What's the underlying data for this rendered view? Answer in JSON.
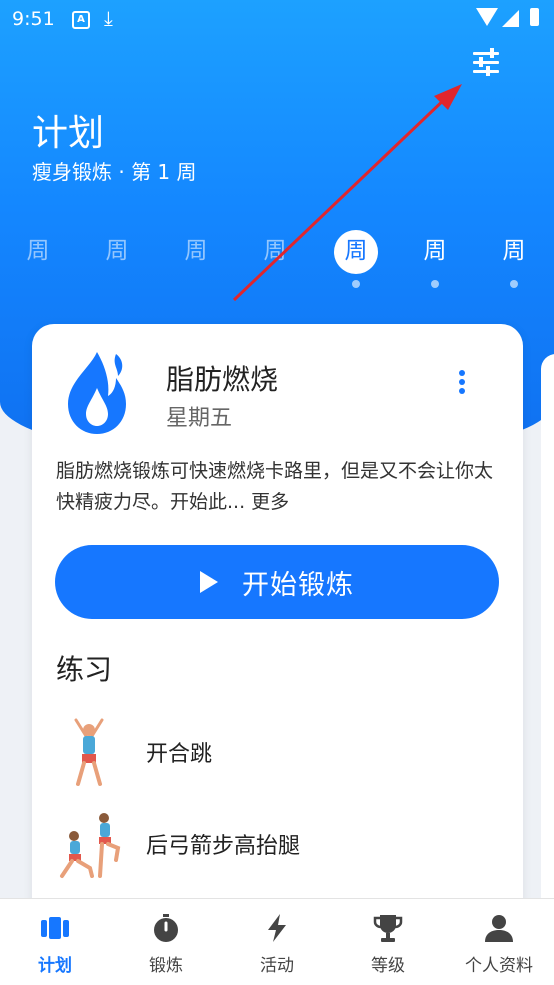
{
  "status_bar": {
    "time": "9:51",
    "icons": [
      "a-icon",
      "download-icon",
      "wifi-icon",
      "signal-icon",
      "battery-icon"
    ]
  },
  "header": {
    "title": "计划",
    "subtitle": "瘦身锻炼 · 第 1 周",
    "filter_icon": "sliders-icon",
    "week_days": [
      "周",
      "周",
      "周",
      "周",
      "周",
      "周",
      "周"
    ],
    "active_day_index": 4
  },
  "workout": {
    "icon": "flame-icon",
    "title": "脂肪燃烧",
    "day": "星期五",
    "description": "脂肪燃烧锻炼可快速燃烧卡路里，但是又不会让你太快精疲力尽。开始此...",
    "more_link": "更多",
    "start_label": "开始锻炼"
  },
  "exercises": {
    "heading": "练习",
    "items": [
      {
        "name": "开合跳"
      },
      {
        "name": "后弓箭步高抬腿"
      }
    ]
  },
  "tabs": [
    {
      "label": "计划",
      "icon": "plan-icon",
      "active": true
    },
    {
      "label": "锻炼",
      "icon": "stopwatch-icon",
      "active": false
    },
    {
      "label": "活动",
      "icon": "bolt-icon",
      "active": false
    },
    {
      "label": "等级",
      "icon": "trophy-icon",
      "active": false
    },
    {
      "label": "个人资料",
      "icon": "person-icon",
      "active": false
    }
  ],
  "colors": {
    "primary": "#1677ff",
    "hero_top": "#1da1ff",
    "annotation_arrow": "#e0262d"
  }
}
